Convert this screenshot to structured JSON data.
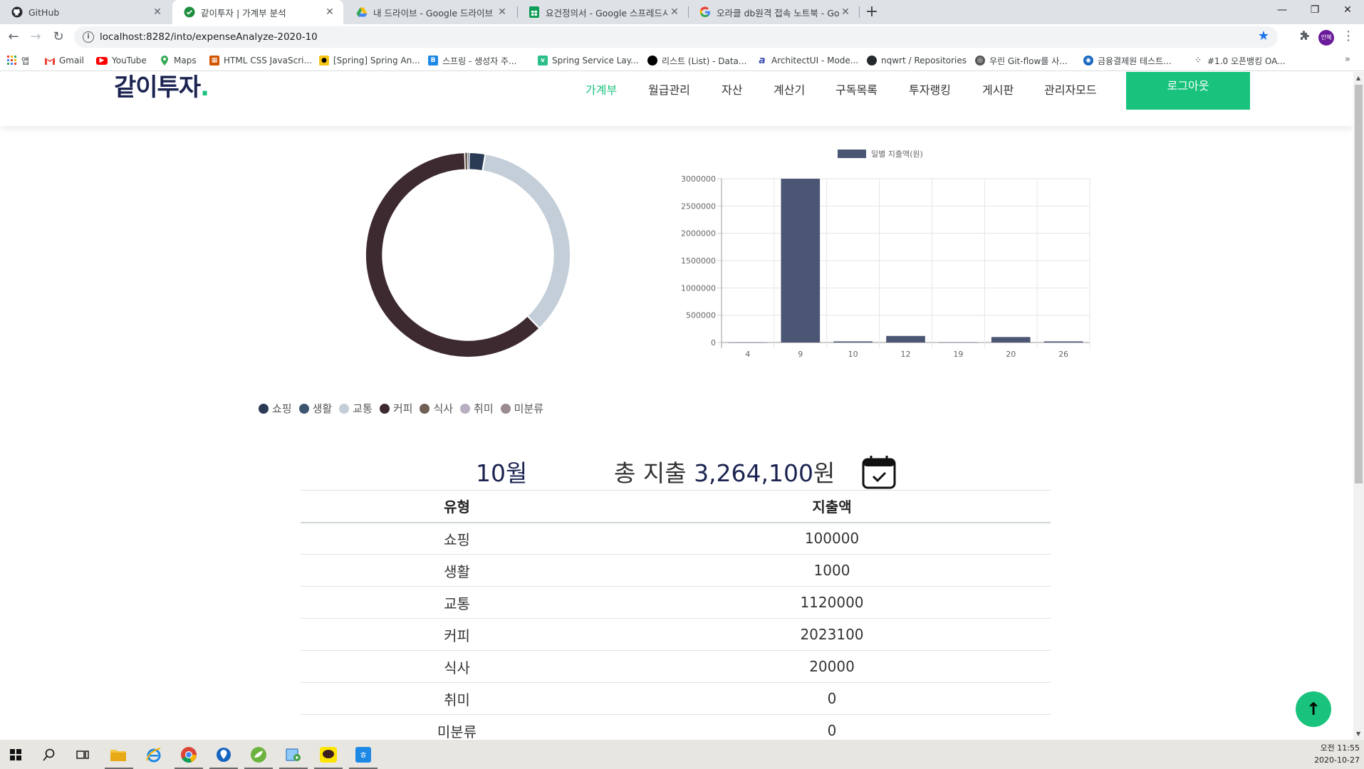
{
  "browser": {
    "tabs": [
      {
        "title": "GitHub",
        "icon": "github-icon"
      },
      {
        "title": "같이투자 | 가계부 분석",
        "icon": "check-circle-icon"
      },
      {
        "title": "내 드라이브 - Google 드라이브",
        "icon": "google-drive-icon"
      },
      {
        "title": "요건정의서 - Google 스프레드시",
        "icon": "google-sheets-icon"
      },
      {
        "title": "오라클 db원격 접속 노트북 - Go",
        "icon": "google-icon"
      }
    ],
    "url": "localhost:8282/into/expenseAnalyze-2020-10",
    "profile_initials": "안혜",
    "bookmarks": [
      {
        "label": "앱",
        "icon": "apps-grid-icon"
      },
      {
        "label": "Gmail",
        "icon": "gmail-icon"
      },
      {
        "label": "YouTube",
        "icon": "youtube-icon"
      },
      {
        "label": "Maps",
        "icon": "maps-pin-icon"
      },
      {
        "label": "HTML CSS JavaScri...",
        "icon": "html-icon"
      },
      {
        "label": "[Spring] Spring An...",
        "icon": "penguin-icon"
      },
      {
        "label": "스프링 - 생성자 주...",
        "icon": "blog-b-icon"
      },
      {
        "label": "Spring Service Lay...",
        "icon": "vuejs-icon"
      },
      {
        "label": "리스트 (List) - Data...",
        "icon": "black-circle-icon"
      },
      {
        "label": "ArchitectUI - Mode...",
        "icon": "architect-a-icon"
      },
      {
        "label": "nqwrt / Repositories",
        "icon": "github-icon"
      },
      {
        "label": "우린 Git-flow를 사...",
        "icon": "globe-icon"
      },
      {
        "label": "금융결제원 테스트...",
        "icon": "kftc-icon"
      },
      {
        "label": "#1.0 오픈뱅킹 OA...",
        "icon": "dots-icon"
      }
    ]
  },
  "site": {
    "logo": "같이투자",
    "logo_dot": ".",
    "nav": [
      "가계부",
      "월급관리",
      "자산",
      "계산기",
      "구독목록",
      "투자랭킹",
      "게시판",
      "관리자모드"
    ],
    "logout_label": "로그아웃"
  },
  "donut": {
    "legend": [
      {
        "label": "쇼핑",
        "color": "#2b3a55"
      },
      {
        "label": "생활",
        "color": "#3d5570"
      },
      {
        "label": "교통",
        "color": "#c3ced9"
      },
      {
        "label": "커피",
        "color": "#3d2a30"
      },
      {
        "label": "식사",
        "color": "#6f5f55"
      },
      {
        "label": "취미",
        "color": "#b8afc0"
      },
      {
        "label": "미분류",
        "color": "#9c8a92"
      }
    ]
  },
  "chart_data": {
    "type": "bar",
    "legend": "일별 지출액(원)",
    "categories": [
      "4",
      "9",
      "10",
      "12",
      "19",
      "20",
      "26"
    ],
    "values": [
      1000,
      3000000,
      20000,
      120000,
      3100,
      100000,
      20000
    ],
    "ylim": [
      0,
      3000000
    ],
    "yticks": [
      "3000000",
      "2500000",
      "2000000",
      "1500000",
      "1000000",
      "500000",
      "0"
    ],
    "bar_color": "#4b5574",
    "grid": true
  },
  "summary": {
    "month": "10월",
    "total_prefix": "총 지출 ",
    "total_amount": "3,264,100",
    "total_suffix": "원"
  },
  "table": {
    "headers": [
      "유형",
      "지출액"
    ],
    "rows": [
      [
        "쇼핑",
        "100000"
      ],
      [
        "생활",
        "1000"
      ],
      [
        "교통",
        "1120000"
      ],
      [
        "커피",
        "2023100"
      ],
      [
        "식사",
        "20000"
      ],
      [
        "취미",
        "0"
      ],
      [
        "미분류",
        "0"
      ]
    ]
  },
  "scroll_top_icon": "arrow-up-icon",
  "taskbar": {
    "time": "오전 11:55",
    "date": "2020-10-27"
  }
}
